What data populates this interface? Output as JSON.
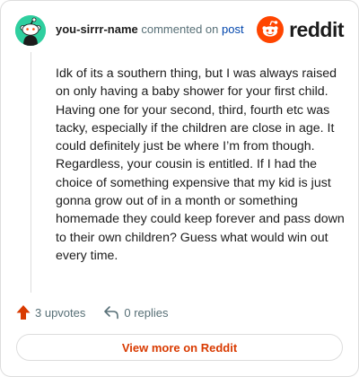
{
  "comment": {
    "username": "you-sirrr-name",
    "commented_text": "commented on",
    "post_link": "post",
    "body": "Idk of its a southern thing, but I was always raised on only having a baby shower for your first child. Having one for your second, third, fourth etc was tacky, especially if the children are close in age. It could definitely just be where I’m from though. Regardless, your cousin is entitled. If I had the choice of something expensive that my kid is just gonna grow out of in a month or something homemade they could keep forever and pass down to their own children? Guess what would win out every time."
  },
  "brand": {
    "wordmark": "reddit",
    "icon": "reddit-snoo-icon",
    "color": "#ff4500"
  },
  "actions": {
    "upvotes": "3 upvotes",
    "replies": "0 replies",
    "upvote_icon": "upvote-arrow-icon",
    "reply_icon": "reply-arrow-icon",
    "upvote_color": "#d93a00"
  },
  "footer": {
    "view_more_label": "View more on Reddit"
  },
  "avatar": {
    "icon": "snoo-avatar-icon",
    "color": "#2fcf9f"
  }
}
